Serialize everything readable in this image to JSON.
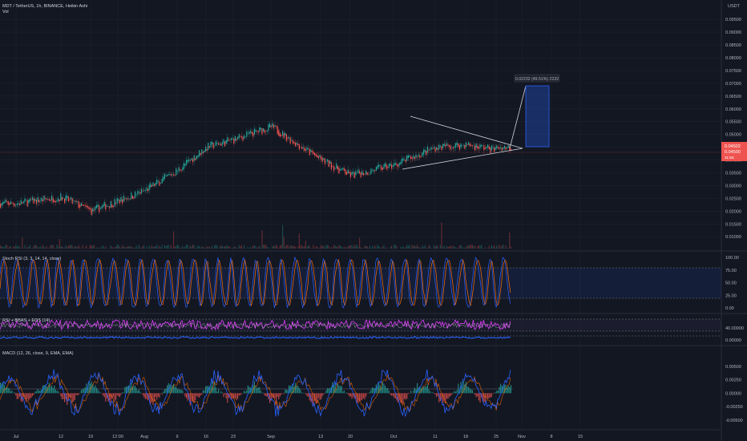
{
  "header": {
    "symbol_line": "MDT / TetherUS, 1h, BINANCE, Heikin Ashi",
    "vol_label": "Vol",
    "currency": "USDT"
  },
  "price_tag": {
    "value1": "0.04502",
    "value2": "0.04500",
    "sub": "11:55"
  },
  "measure_label": "0.02232 (49.51%) 2232",
  "colors": {
    "background": "#131722",
    "up": "#26a69a",
    "down": "#ef5350",
    "stoch_k": "#2962ff",
    "stoch_d": "#ff6d00",
    "rsi": "#e040fb",
    "macd": "#2962ff",
    "signal": "#ff6d00",
    "projection": "#2962ff"
  },
  "chart_data": [
    {
      "type": "candlestick",
      "title": "MDT / TetherUS, 1h, BINANCE, Heikin Ashi",
      "x_ticks": [
        "Jul",
        "12",
        "19",
        "12:00",
        "Aug",
        "9",
        "16",
        "23",
        "Sep",
        "13",
        "20",
        "Oct",
        "11",
        "18",
        "25",
        "Nov",
        "8",
        "15"
      ],
      "y_ticks": [
        "0.09500",
        "0.09000",
        "0.08500",
        "0.08000",
        "0.07500",
        "0.07000",
        "0.06500",
        "0.06000",
        "0.05500",
        "0.05000",
        "0.04500",
        "0.04000",
        "0.03500",
        "0.03000",
        "0.02500",
        "0.02000",
        "0.01500",
        "0.01000"
      ],
      "ylim": [
        0.0085,
        0.0985
      ],
      "approx_close_path": [
        {
          "x": "Jul",
          "y": 0.023
        },
        {
          "x": "12",
          "y": 0.0255
        },
        {
          "x": "19",
          "y": 0.02
        },
        {
          "x": "12:00",
          "y": 0.024
        },
        {
          "x": "Aug",
          "y": 0.028
        },
        {
          "x": "9",
          "y": 0.036
        },
        {
          "x": "16",
          "y": 0.045
        },
        {
          "x": "23",
          "y": 0.048
        },
        {
          "x": "Sep",
          "y": 0.053
        },
        {
          "x": "13",
          "y": 0.04
        },
        {
          "x": "20",
          "y": 0.034
        },
        {
          "x": "Oct",
          "y": 0.038
        },
        {
          "x": "11",
          "y": 0.045
        },
        {
          "x": "18",
          "y": 0.046
        },
        {
          "x": "25",
          "y": 0.044
        }
      ],
      "last_price": 0.045
    },
    {
      "type": "line",
      "title": "Stoch RSI (3, 3, 14, 14, close)",
      "y_ticks": [
        "100.00",
        "75.00",
        "50.00",
        "25.00",
        "0.00"
      ],
      "ylim": [
        0,
        100
      ],
      "bands": [
        20,
        80
      ]
    },
    {
      "type": "line",
      "title": "RSI + BBAS + EOS (14)",
      "y_ticks": [
        "40.00000",
        "0.00000"
      ],
      "series": [
        {
          "name": "RSI",
          "approx_value": 50
        }
      ]
    },
    {
      "type": "bar",
      "title": "MACD (12, 26, close, 9, EMA, EMA)",
      "y_ticks": [
        "0.00500",
        "0.00250",
        "0.00000",
        "-0.00250",
        "-0.00500"
      ],
      "ylim": [
        -0.0065,
        0.0075
      ]
    }
  ]
}
